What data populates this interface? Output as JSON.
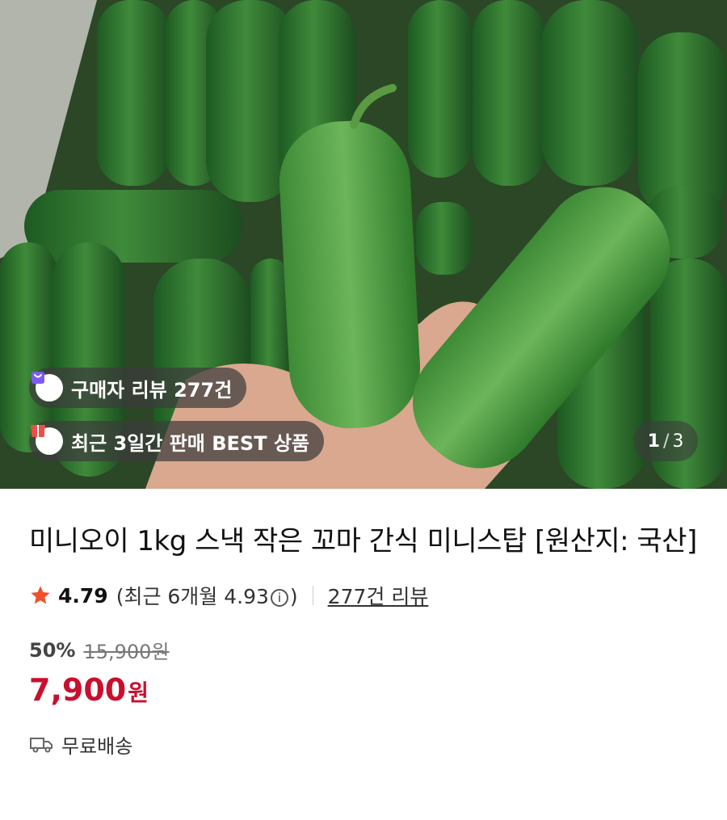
{
  "product": {
    "image_alt": "cucumbers",
    "badges": {
      "review": {
        "label": "구매자 리뷰 277건",
        "icon": "shopping-bag-icon"
      },
      "best": {
        "label": "최근 3일간 판매 BEST 상품",
        "icon": "gift-box-icon"
      }
    },
    "gallery": {
      "current": "1",
      "separator": "/",
      "total": "3"
    },
    "title": "미니오이 1kg 스낵 작은 꼬마 간식 미니스탑 [원산지: 국산]",
    "rating": {
      "score": "4.79",
      "recent_prefix": "(최근 6개월 4.93",
      "recent_suffix": ")",
      "info_symbol": "i",
      "review_link": "277건 리뷰"
    },
    "pricing": {
      "discount": "50%",
      "original_price": "15,900원",
      "price": "7,900",
      "currency": "원"
    },
    "shipping": {
      "label": "무료배송",
      "icon": "delivery-truck-icon"
    }
  },
  "colors": {
    "price_red": "#c8102e",
    "star_orange": "#f0502d",
    "badge_purple": "#7b5cf0",
    "badge_red": "#e8504a"
  }
}
